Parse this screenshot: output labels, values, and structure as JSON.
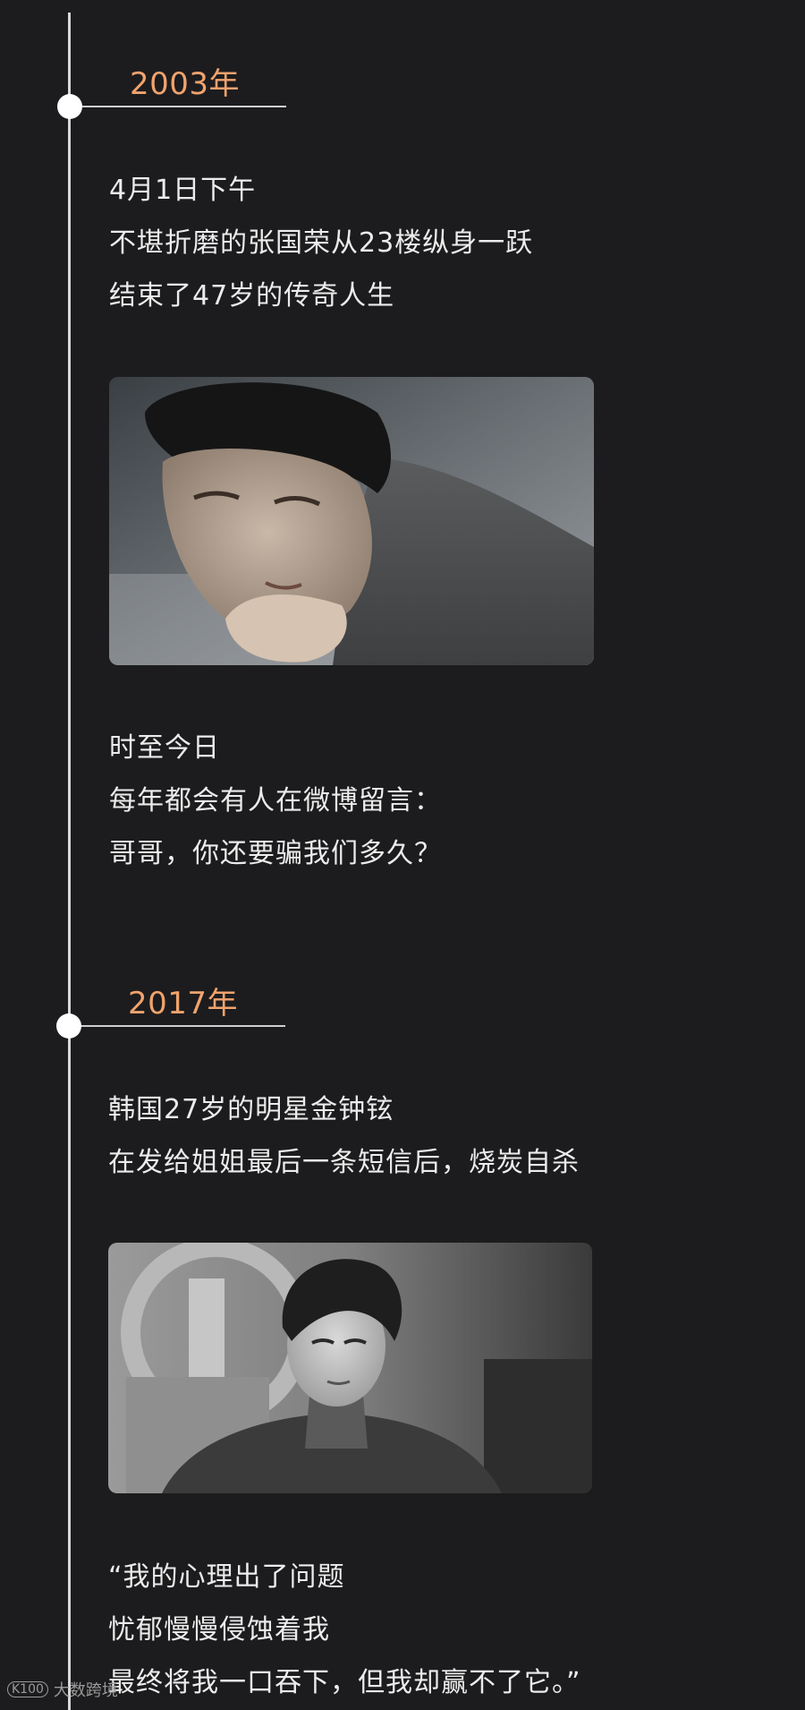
{
  "timeline": [
    {
      "year": "2003年",
      "lines_before": [
        "4月1日下午",
        "不堪折磨的张国荣从23楼纵身一跃",
        "结束了47岁的传奇人生"
      ],
      "lines_after": [
        "时至今日",
        "每年都会有人在微博留言：",
        "哥哥，你还要骗我们多久？"
      ]
    },
    {
      "year": "2017年",
      "lines_before": [
        "韩国27岁的明星金钟铉",
        "在发给姐姐最后一条短信后，烧炭自杀"
      ],
      "lines_after": [
        "“我的心理出了问题",
        "忧郁慢慢侵蚀着我",
        "最终将我一口吞下，但我却赢不了它。”"
      ]
    }
  ],
  "watermark": {
    "text": "大数跨境",
    "logo": "K100"
  },
  "colors": {
    "background": "#1c1c1e",
    "year_accent": "#f0a36d",
    "text": "#ececec",
    "line": "#d9d9d9"
  }
}
